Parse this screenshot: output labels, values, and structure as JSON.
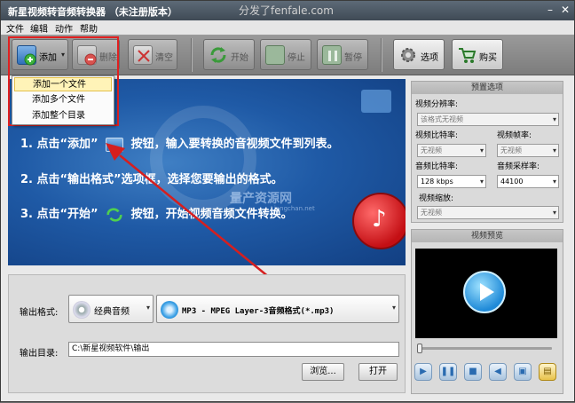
{
  "window": {
    "title": "新星视频转音频转换器 （未注册版本）",
    "watermark": "分发了fenfale.com"
  },
  "menubar": [
    "文件",
    "编辑",
    "动作",
    "帮助"
  ],
  "toolbar": {
    "add": "添加",
    "delete": "删除",
    "clear": "清空",
    "start": "开始",
    "stop": "停止",
    "pause": "暂停",
    "options": "选项",
    "buy": "购买"
  },
  "add_menu": [
    "添加一个文件",
    "添加多个文件",
    "添加整个目录"
  ],
  "banner": {
    "step1_a": "1. 点击“添加”",
    "step1_b": "按钮，输入要转换的音视频文件到列表。",
    "step2": "2. 点击“输出格式”选项框，选择您要输出的格式。",
    "step3_a": "3. 点击“开始”",
    "step3_b": "按钮，开始视频音频文件转换。",
    "watermark": "量产资源网",
    "watermark_sub": "Liangchan.net"
  },
  "output": {
    "format_label": "输出格式:",
    "category": "经典音频",
    "format": "MP3 - MPEG Layer-3音频格式(*.mp3)",
    "dir_label": "输出目录:",
    "dir": "C:\\新星视频软件\\输出",
    "browse": "浏览...",
    "open": "打开"
  },
  "preset": {
    "header": "预置选项",
    "video_res_label": "视频分辨率:",
    "video_res": "该格式无视频",
    "video_bitrate_label": "视频比特率:",
    "video_bitrate": "无视频",
    "video_fps_label": "视频帧率:",
    "video_fps": "无视频",
    "audio_bitrate_label": "音频比特率:",
    "audio_bitrate": "128 kbps",
    "audio_samplerate_label": "音频采样率:",
    "audio_samplerate": "44100",
    "video_scale_label": "视频缩放:",
    "video_scale": "无视频"
  },
  "preview": {
    "header": "视频预览"
  },
  "colors": {
    "banner": "#1f5aa6",
    "highlight": "#e02020",
    "menu_selected": "#fff3b8"
  }
}
